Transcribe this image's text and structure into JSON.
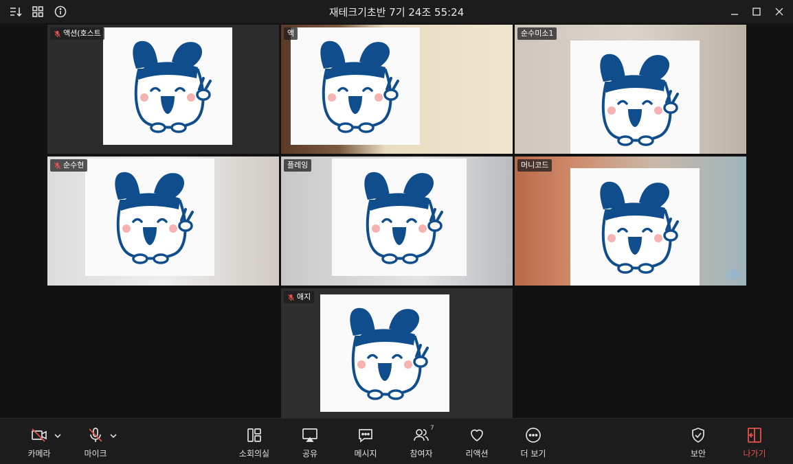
{
  "window": {
    "title": "재테크기초반 7기 24조 55:24"
  },
  "tiles": [
    {
      "name": "액션(호스트",
      "muted": true
    },
    {
      "name": "액",
      "muted": false
    },
    {
      "name": "순수미소1",
      "muted": false
    },
    {
      "name": "순수현",
      "muted": true
    },
    {
      "name": "플레잉",
      "muted": false
    },
    {
      "name": "머니코드",
      "muted": false,
      "speaking": true
    },
    {
      "name": "애지",
      "muted": true
    }
  ],
  "toolbar": {
    "camera": "카메라",
    "mic": "마이크",
    "breakout": "소회의실",
    "share": "공유",
    "message": "메시지",
    "participants": "참여자",
    "participants_count": "7",
    "reaction": "리액션",
    "more": "더 보기",
    "security": "보안",
    "leave": "나가기"
  },
  "colors": {
    "leave": "#e8534a",
    "active_border": "#3ad48f",
    "mascot_blue": "#0f4d8c"
  }
}
